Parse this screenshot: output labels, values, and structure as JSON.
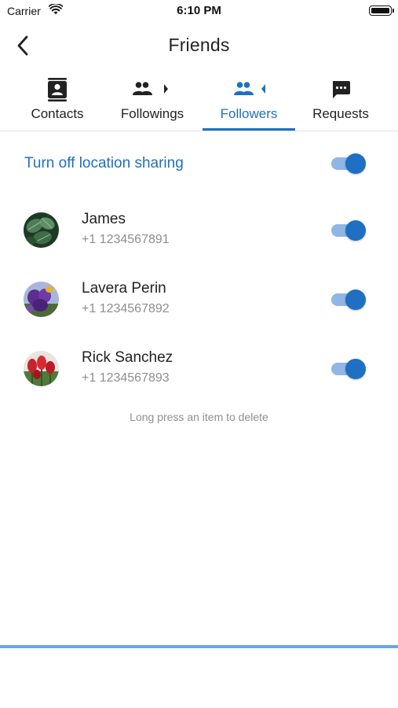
{
  "status_bar": {
    "carrier": "Carrier",
    "time": "6:10 PM",
    "wifi_icon": "wifi-icon",
    "battery_icon": "battery-full-icon"
  },
  "nav": {
    "title": "Friends",
    "back_icon": "chevron-left-icon"
  },
  "tabs": [
    {
      "label": "Contacts",
      "icon": "contacts-book-icon",
      "active": false
    },
    {
      "label": "Followings",
      "icon": "people-arrow-right-icon",
      "active": false
    },
    {
      "label": "Followers",
      "icon": "people-arrow-left-icon",
      "active": true
    },
    {
      "label": "Requests",
      "icon": "chat-bubble-dots-icon",
      "active": false
    }
  ],
  "location_sharing": {
    "label": "Turn off location sharing",
    "enabled": true
  },
  "followers": [
    {
      "name": "James",
      "phone": "+1 1234567891",
      "sharing": true,
      "avatar": "leaf-photo"
    },
    {
      "name": "Lavera Perin",
      "phone": "+1 1234567892",
      "sharing": true,
      "avatar": "purple-flowers-photo"
    },
    {
      "name": "Rick Sanchez",
      "phone": "+1 1234567893",
      "sharing": true,
      "avatar": "red-tulips-photo"
    }
  ],
  "hint": "Long press an item to delete",
  "colors": {
    "accent": "#1f6fc2",
    "toggle_track": "#8fb6e4",
    "secondary_text": "#8e8e8e",
    "bottom_bar": "#63a8e8"
  }
}
